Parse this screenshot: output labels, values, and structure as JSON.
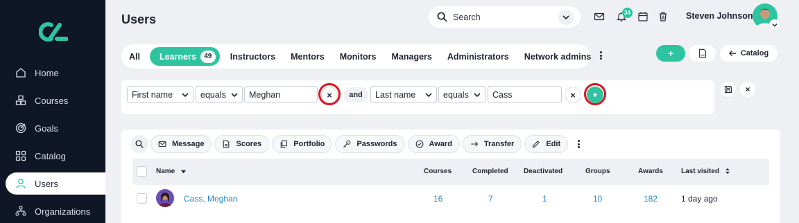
{
  "app": {
    "page_title": "Users"
  },
  "sidebar": {
    "items": [
      {
        "label": "Home",
        "icon": "home-icon"
      },
      {
        "label": "Courses",
        "icon": "courses-icon"
      },
      {
        "label": "Goals",
        "icon": "target-icon"
      },
      {
        "label": "Catalog",
        "icon": "grid-icon"
      },
      {
        "label": "Users",
        "icon": "user-icon",
        "active": true
      },
      {
        "label": "Organizations",
        "icon": "org-icon"
      }
    ]
  },
  "header": {
    "search_placeholder": "Search",
    "notification_count": "34",
    "user_name": "Steven Johnson"
  },
  "tabs": [
    {
      "label": "All"
    },
    {
      "label": "Learners",
      "count": "49",
      "active": true
    },
    {
      "label": "Instructors"
    },
    {
      "label": "Mentors"
    },
    {
      "label": "Monitors"
    },
    {
      "label": "Managers"
    },
    {
      "label": "Administrators"
    },
    {
      "label": "Network admins"
    }
  ],
  "toolbar": {
    "add_label": "+",
    "catalog_label": "Catalog"
  },
  "filter": {
    "field1": "First name",
    "op1": "equals",
    "value1": "Meghan",
    "conjunction": "and",
    "field2": "Last name",
    "op2": "equals",
    "value2": "Cass",
    "add_label": "+"
  },
  "actions": [
    "Message",
    "Scores",
    "Portfolio",
    "Passwords",
    "Award",
    "Transfer",
    "Edit"
  ],
  "table": {
    "columns": [
      "Name",
      "Courses",
      "Completed",
      "Deactivated",
      "Groups",
      "Awards",
      "Last visited"
    ],
    "rows": [
      {
        "name": "Cass, Meghan",
        "courses": "16",
        "completed": "7",
        "deactivated": "1",
        "groups": "10",
        "awards": "182",
        "last_visited": "1 day ago"
      }
    ]
  },
  "colors": {
    "accent": "#2ec4a0",
    "sidebar": "#0f1726",
    "link": "#2b87c9",
    "highlight_ring": "#e0141e"
  }
}
